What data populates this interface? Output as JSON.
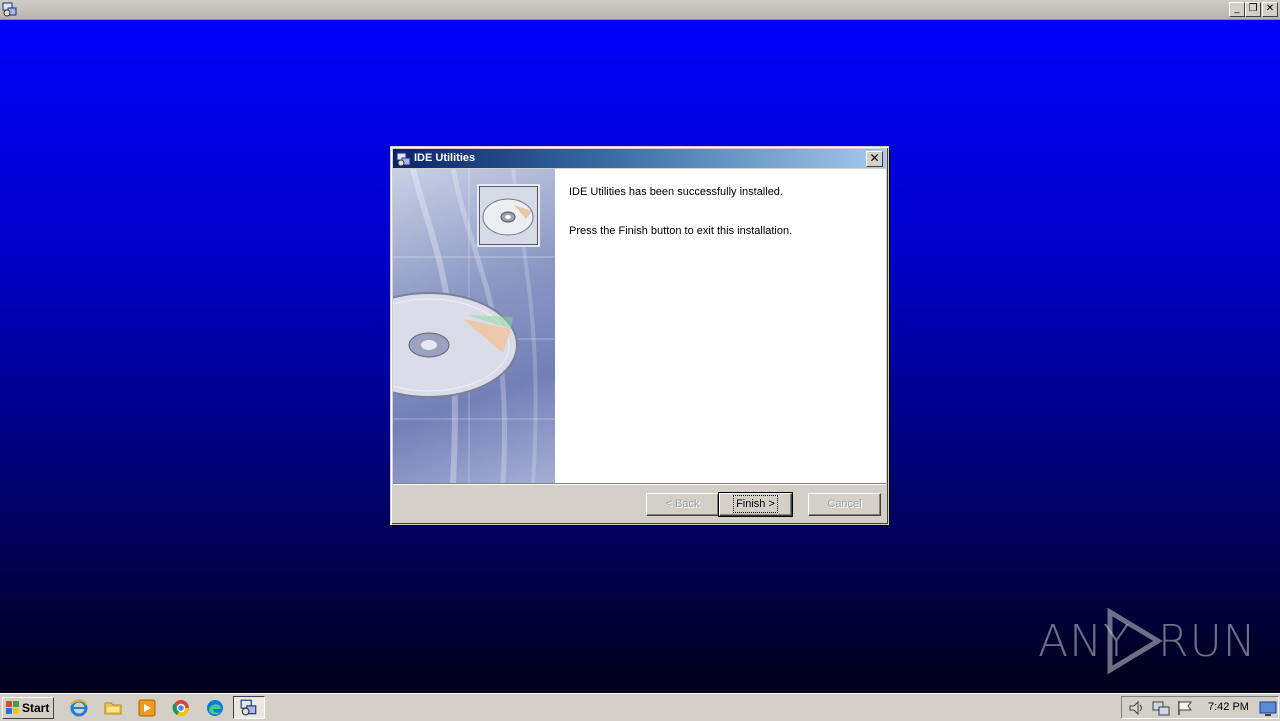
{
  "window": {
    "minimize_glyph": "_",
    "restore_glyph": "❐",
    "close_glyph": "✕"
  },
  "dialog": {
    "title": "IDE Utilities",
    "close_glyph": "✕",
    "message_1": "IDE Utilities has been successfully installed.",
    "message_2": "Press the Finish button to exit this installation.",
    "buttons": {
      "back": "< Back",
      "finish": "Finish >",
      "cancel": "Cancel"
    },
    "side_image": "cd-disc-graphic"
  },
  "taskbar": {
    "start_label": "Start",
    "pinned_icons": [
      "internet-explorer-icon",
      "folder-icon",
      "media-player-icon",
      "chrome-icon",
      "edge-icon"
    ],
    "active_task_icon": "installer-icon",
    "tray_icons": [
      "volume-icon",
      "network-icon",
      "flag-icon",
      "show-desktop-icon"
    ],
    "clock": "7:42 PM"
  },
  "watermark": {
    "left": "ANY",
    "right": "RUN"
  },
  "colors": {
    "desktop_top": "#0000fa",
    "desktop_bottom": "#000018",
    "title_active": "#0a246a",
    "face": "#d4d0c8"
  }
}
